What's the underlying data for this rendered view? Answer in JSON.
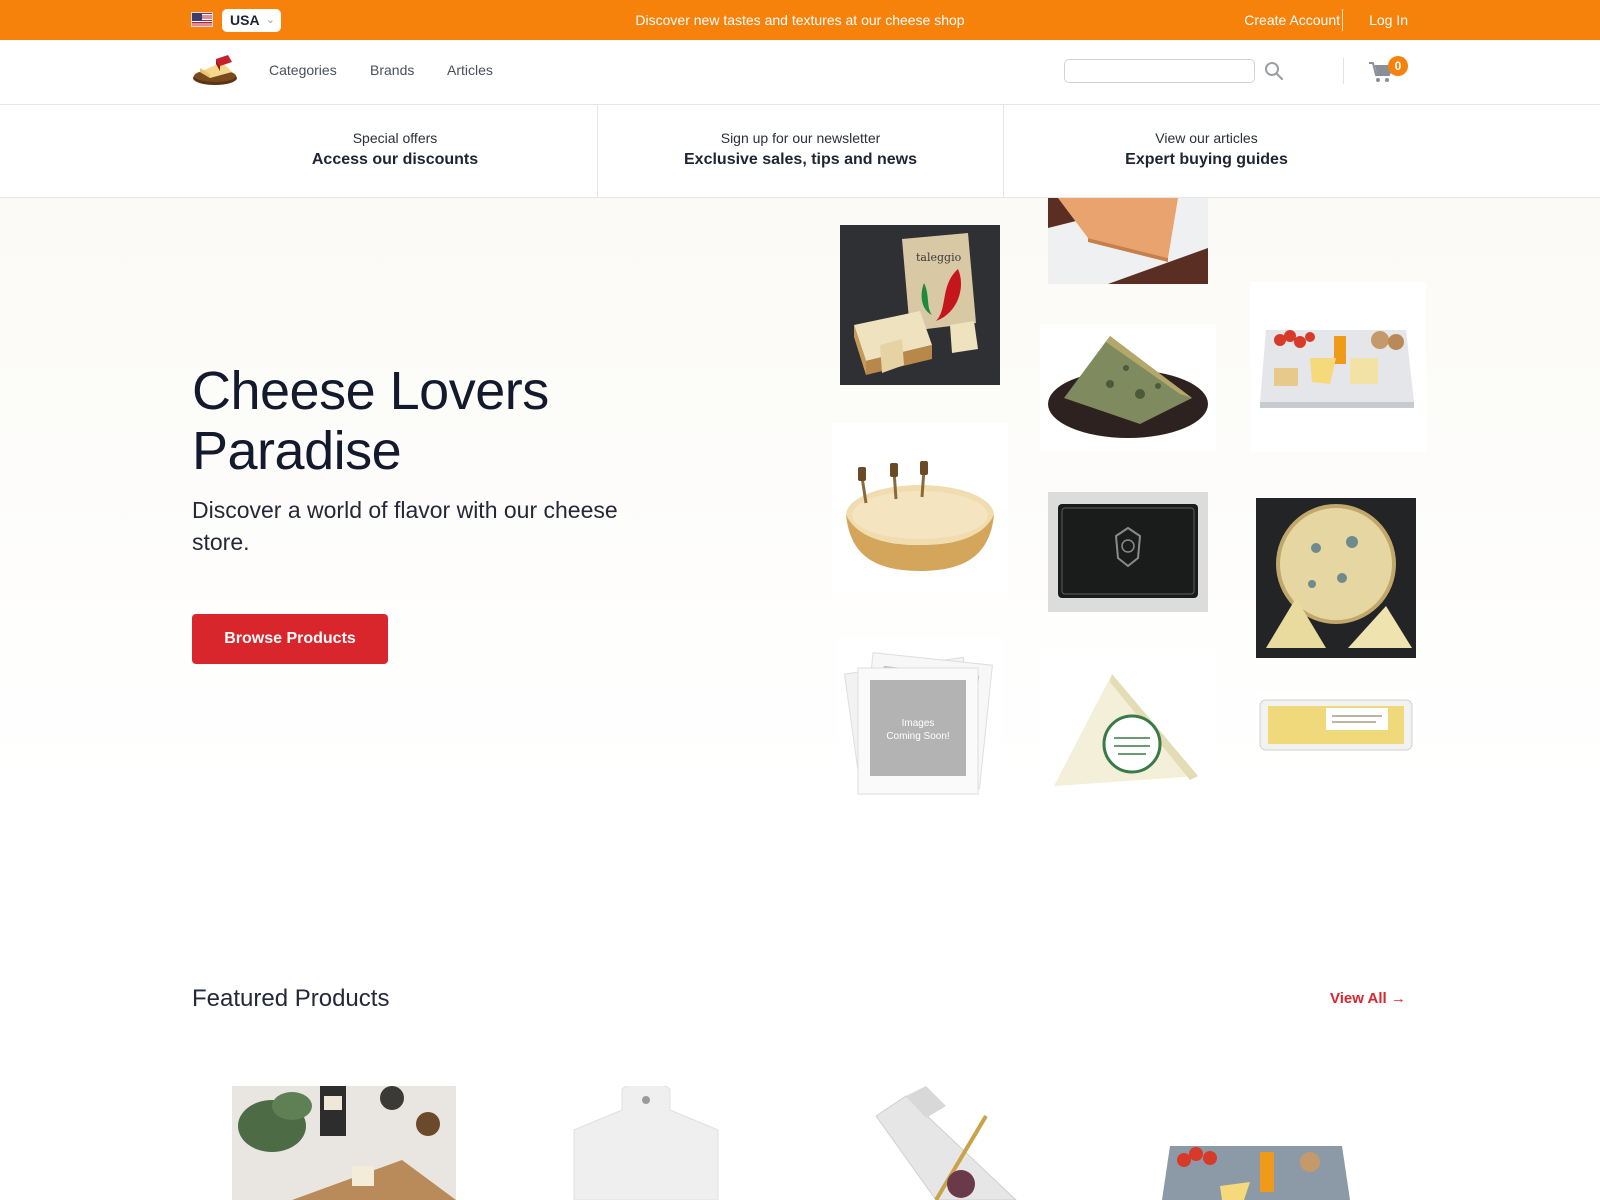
{
  "topbar": {
    "country": "USA",
    "promo": "Discover new tastes and textures at our cheese shop",
    "create_account": "Create Account",
    "login": "Log In"
  },
  "header": {
    "nav": [
      "Categories",
      "Brands",
      "Articles"
    ],
    "search": {
      "value": "",
      "placeholder": ""
    },
    "cart_count": "0"
  },
  "strip": [
    {
      "small": "Special offers",
      "big": "Access our discounts"
    },
    {
      "small": "Sign up for our newsletter",
      "big": "Exclusive sales, tips and news"
    },
    {
      "small": "View our articles",
      "big": "Expert buying guides"
    }
  ],
  "hero": {
    "title_line1": "Cheese Lovers",
    "title_line2": "Paradise",
    "subtitle": "Discover a world of flavor with our cheese store.",
    "button": "Browse Products",
    "placeholder_text_1": "Images",
    "placeholder_text_2": "Coming Soon!",
    "product_label": "taleggio"
  },
  "featured": {
    "title": "Featured Products",
    "view_all": "View All →"
  },
  "colors": {
    "accent_orange": "#f6820c",
    "cta_red": "#d9262c",
    "heading_navy": "#141a2e"
  },
  "icons": [
    "us-flag-icon",
    "chevron-down-icon",
    "cheese-logo-icon",
    "search-icon",
    "cart-icon"
  ]
}
